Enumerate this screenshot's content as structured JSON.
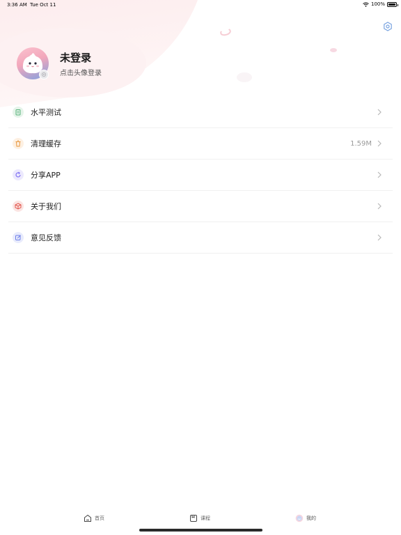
{
  "status_bar": {
    "time": "3:36 AM",
    "date": "Tue Oct 11",
    "battery": "100%",
    "battery_level": 1.0,
    "wifi_icon": "wifi-icon"
  },
  "header": {
    "settings_icon": "gear-icon",
    "username": "未登录",
    "login_hint": "点击头像登录"
  },
  "menu": {
    "items": [
      {
        "label": "水平测试",
        "value": "",
        "icon": "clipboard-icon",
        "color": "#57b27a"
      },
      {
        "label": "清理缓存",
        "value": "1.59M",
        "icon": "trash-icon",
        "color": "#e8963c"
      },
      {
        "label": "分享APP",
        "value": "",
        "icon": "share-icon",
        "color": "#7b6cf2"
      },
      {
        "label": "关于我们",
        "value": "",
        "icon": "cube-icon",
        "color": "#e2564d"
      },
      {
        "label": "意见反馈",
        "value": "",
        "icon": "feedback-icon",
        "color": "#6b7de8"
      }
    ]
  },
  "tabbar": {
    "tabs": [
      {
        "label": "首页",
        "icon": "home-icon"
      },
      {
        "label": "课程",
        "icon": "course-icon"
      },
      {
        "label": "我的",
        "icon": "profile-icon",
        "active": true
      }
    ]
  },
  "colors": {
    "header_bg": "#fde9ea",
    "accent_pink": "#f2a7bb"
  }
}
